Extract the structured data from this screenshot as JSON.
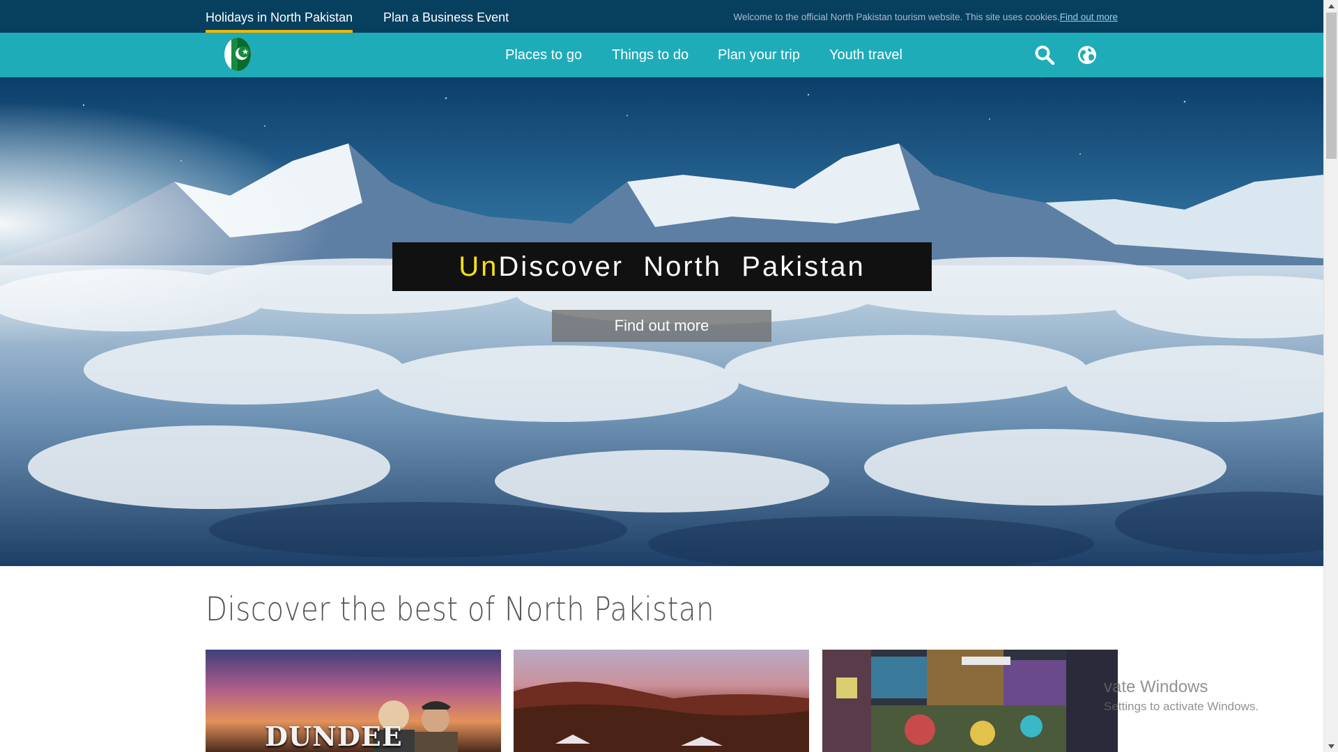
{
  "topbar": {
    "tabs": [
      {
        "label": "Holidays in North Pakistan",
        "active": true
      },
      {
        "label": "Plan a Business Event",
        "active": false
      }
    ],
    "notice_text": "Welcome to the official North Pakistan tourism website. This site uses cookies.",
    "notice_link": "Find out more"
  },
  "nav": {
    "logo_icon": "pakistan-flag-icon",
    "items": [
      "Places to go",
      "Things to do",
      "Plan your trip",
      "Youth travel"
    ],
    "search_icon": "search-icon",
    "globe_icon": "globe-icon"
  },
  "hero": {
    "title_highlight": "Un",
    "title_rest": "Discover  North  Pakistan",
    "button_label": "Find out more"
  },
  "section": {
    "title": "Discover the best of North Pakistan",
    "cards": [
      {
        "caption": "DUNDEE",
        "image": "movie-poster-sunset"
      },
      {
        "caption": "",
        "image": "desert-tents-dusk"
      },
      {
        "caption": "",
        "image": "graffiti-laneway"
      }
    ]
  },
  "watermark": {
    "line1": "vate Windows",
    "line2": "Settings to activate Windows."
  },
  "colors": {
    "topbar": "#073f5f",
    "navbar": "#1eacb8",
    "tab_underline": "#f2b705",
    "title_highlight": "#f7e016"
  }
}
